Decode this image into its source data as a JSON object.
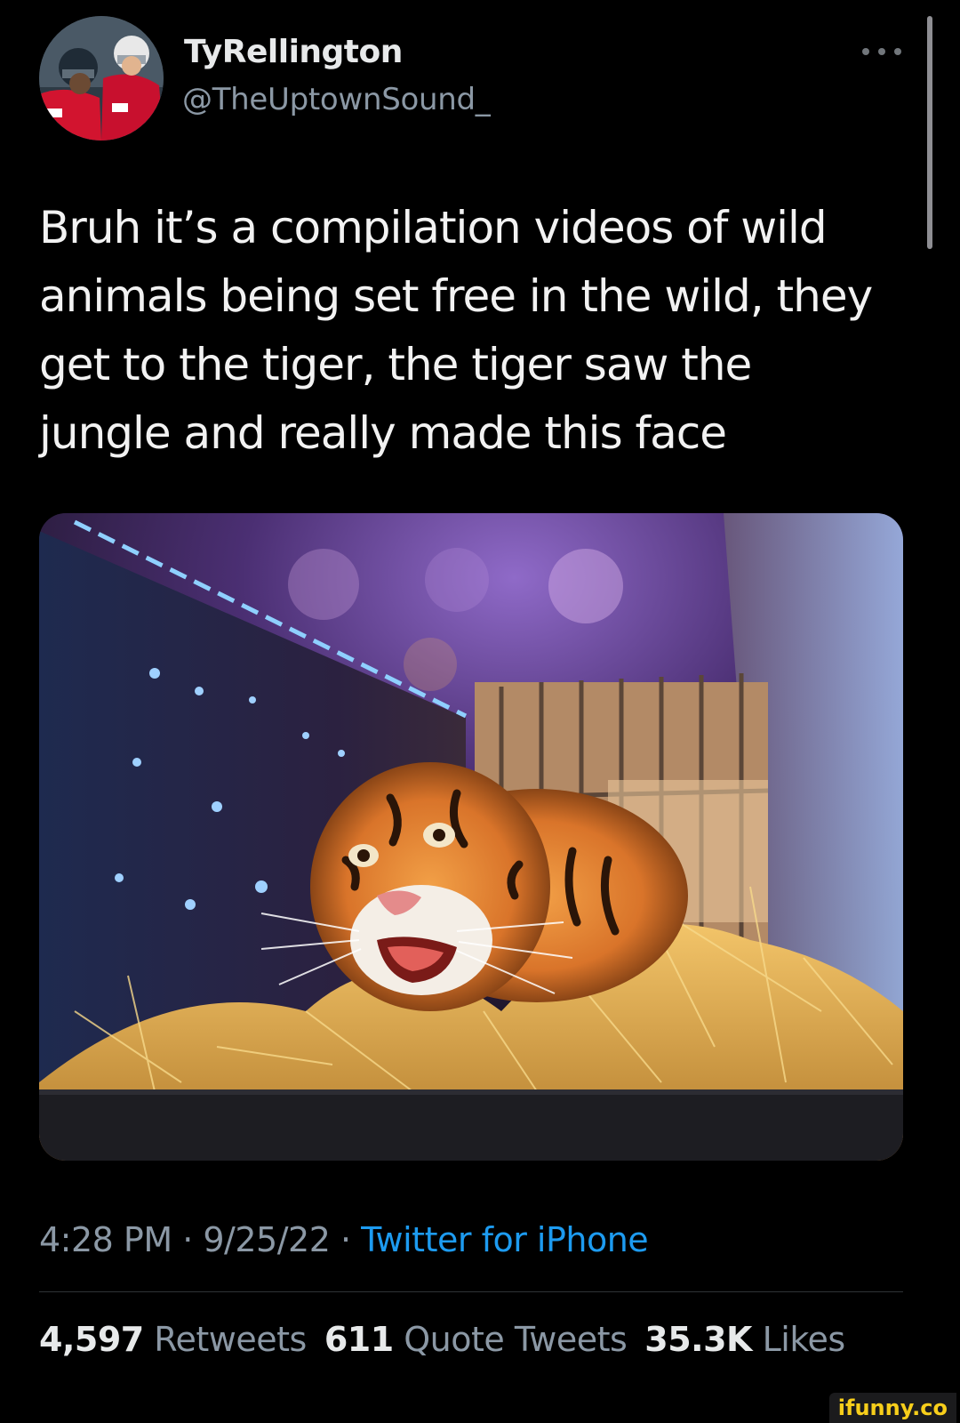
{
  "author": {
    "display_name": "TyRellington",
    "handle": "@TheUptownSound_"
  },
  "tweet": {
    "text": "Bruh it’s a compilation videos of wild\nanimals being set free in the wild, they\nget to the tiger, the tiger saw the\njungle and really made this face",
    "media_description_icon": "tiger-photo"
  },
  "meta": {
    "time": "4:28 PM",
    "separator": " · ",
    "date": "9/25/22",
    "source": "Twitter for iPhone"
  },
  "stats": {
    "retweets_count": "4,597",
    "retweets_label": "Retweets",
    "quotes_count": "611",
    "quotes_label": "Quote Tweets",
    "likes_count": "35.3K",
    "likes_label": "Likes"
  },
  "watermark": "ifunny.co",
  "colors": {
    "background": "#000000",
    "primary_text": "#e7e9ea",
    "secondary_text": "#8b98a5",
    "link": "#1d9bf0",
    "watermark": "#f7ce1b"
  }
}
